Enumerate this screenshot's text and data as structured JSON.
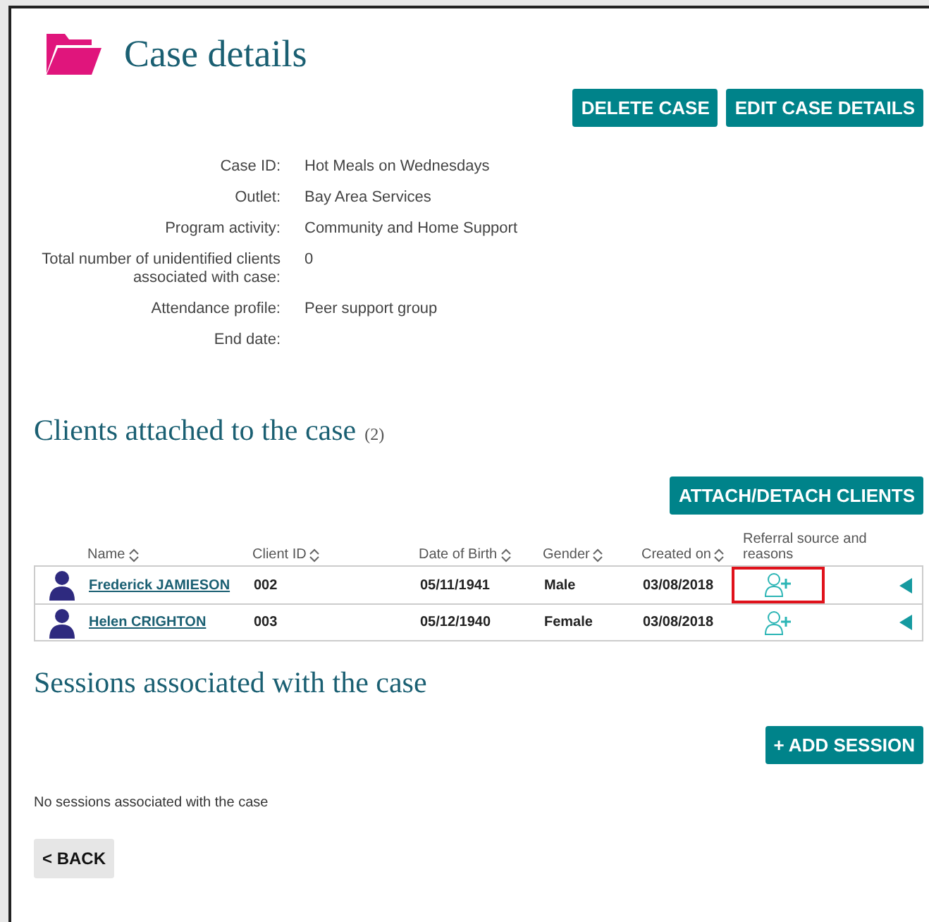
{
  "title": "Case details",
  "actions": [
    "DELETE CASE",
    "EDIT CASE DETAILS"
  ],
  "fields": [
    {
      "label": "Case ID:",
      "value": "Hot Meals on Wednesdays"
    },
    {
      "label": "Outlet:",
      "value": "Bay Area Services"
    },
    {
      "label": "Program activity:",
      "value": "Community and Home Support"
    },
    {
      "label": "Total number of unidentified clients associated with case:",
      "value": "0"
    },
    {
      "label": "Attendance profile:",
      "value": "Peer support group"
    },
    {
      "label": "End date:"
    }
  ],
  "clients_section": {
    "title": "Clients attached to the case",
    "count": "(2)",
    "button": "ATTACH/DETACH CLIENTS"
  },
  "table": {
    "columns": [
      "Name",
      "Client ID",
      "Date of Birth",
      "Gender",
      "Created on",
      "Referral source and reasons"
    ],
    "rows": [
      {
        "name": "Frederick JAMIESON",
        "id": "002",
        "dob": "05/11/1941",
        "gender": "Male",
        "created": "03/08/2018",
        "highlighted": true
      },
      {
        "name": "Helen CRIGHTON",
        "id": "003",
        "dob": "05/12/1940",
        "gender": "Female",
        "created": "03/08/2018",
        "highlighted": false
      }
    ]
  },
  "sessions_section": {
    "title": "Sessions associated with the case",
    "button": "+ ADD SESSION",
    "empty": "No sessions associated with the case"
  },
  "back": "< BACK"
}
